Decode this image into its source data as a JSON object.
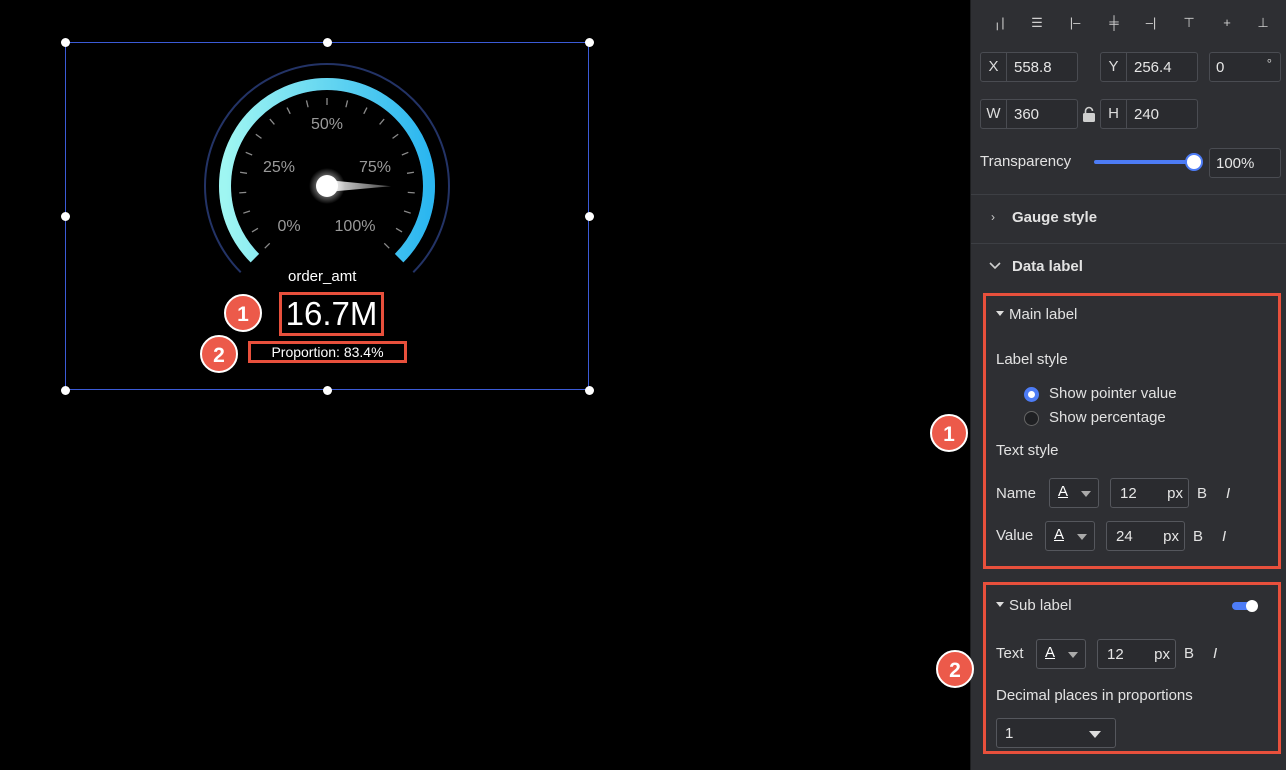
{
  "canvas": {
    "gauge": {
      "tick_labels": [
        "0%",
        "25%",
        "50%",
        "75%",
        "100%"
      ],
      "field_name": "order_amt",
      "value": "16.7M",
      "sub_label": "Proportion: 83.4%",
      "pointer_fraction": 0.834,
      "colors": {
        "arc_start": "#9ff6f2",
        "arc_end": "#2bb6f0",
        "outer_ring": "#233366"
      }
    },
    "markers": [
      "1",
      "2"
    ]
  },
  "panel": {
    "align_icons": [
      "align-left-icon",
      "align-center-h-icon",
      "align-right-icon",
      "distribute-h-icon",
      "align-right-edge-icon",
      "align-top-icon",
      "align-middle-v-icon",
      "align-bottom-icon"
    ],
    "position": {
      "x_label": "X",
      "x_value": "558.8",
      "y_label": "Y",
      "y_value": "256.4",
      "rotation_value": "0",
      "rotation_unit": "°",
      "w_label": "W",
      "w_value": "360",
      "h_label": "H",
      "h_value": "240"
    },
    "transparency": {
      "label": "Transparency",
      "value": "100%",
      "level": 1.0
    },
    "sections": {
      "gauge_style": "Gauge style",
      "data_label": "Data label"
    },
    "main_label": {
      "title": "Main label",
      "label_style_heading": "Label style",
      "options": [
        "Show pointer value",
        "Show percentage"
      ],
      "selected_option": 0,
      "text_style_heading": "Text style",
      "name_row": {
        "label": "Name",
        "font_a": "A",
        "size": "12",
        "unit": "px",
        "bold": "B",
        "italic": "I"
      },
      "value_row": {
        "label": "Value",
        "font_a": "A",
        "size": "24",
        "unit": "px",
        "bold": "B",
        "italic": "I"
      }
    },
    "sub_label": {
      "title": "Sub label",
      "enabled": true,
      "text_row": {
        "label": "Text",
        "font_a": "A",
        "size": "12",
        "unit": "px",
        "bold": "B",
        "italic": "I"
      },
      "decimal_heading": "Decimal places in proportions",
      "decimal_value": "1"
    },
    "markers": [
      "1",
      "2"
    ],
    "colors": {
      "accent": "#4d7cf6",
      "highlight": "#e8503c"
    }
  }
}
